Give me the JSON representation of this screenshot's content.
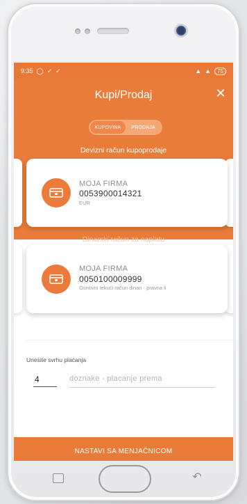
{
  "status_bar": {
    "time": "9:35",
    "left_icons": [
      "shield-icon",
      "signal-check-icon",
      "signal-check-icon"
    ],
    "battery": "75"
  },
  "header": {
    "title": "Kupi/Prodaj",
    "close_icon": "close-icon"
  },
  "toggle": {
    "options": [
      "KUPOVINA",
      "PRODAJA"
    ],
    "selected": "KUPOVINA"
  },
  "sections": {
    "source_label": "Devizni račun kupoprodaje",
    "target_label": "Dinarski račun za naplatu"
  },
  "source_account": {
    "name": "MOJA FIRMA",
    "number": "0053900014321",
    "subtitle": "EUR"
  },
  "target_account": {
    "name": "MOJA FIRMA",
    "number": "0050100009999",
    "subtitle": "Osnovni tekući račun dinari - pravna li"
  },
  "purpose": {
    "label": "Unesite svrhu plaćanja",
    "code": "4",
    "placeholder": "doznake - placanje prema"
  },
  "cta_label": "NASTAVI SA MENJAČNICOM",
  "colors": {
    "accent": "#EA7C3A",
    "toggle_bg": "#F4A878"
  }
}
